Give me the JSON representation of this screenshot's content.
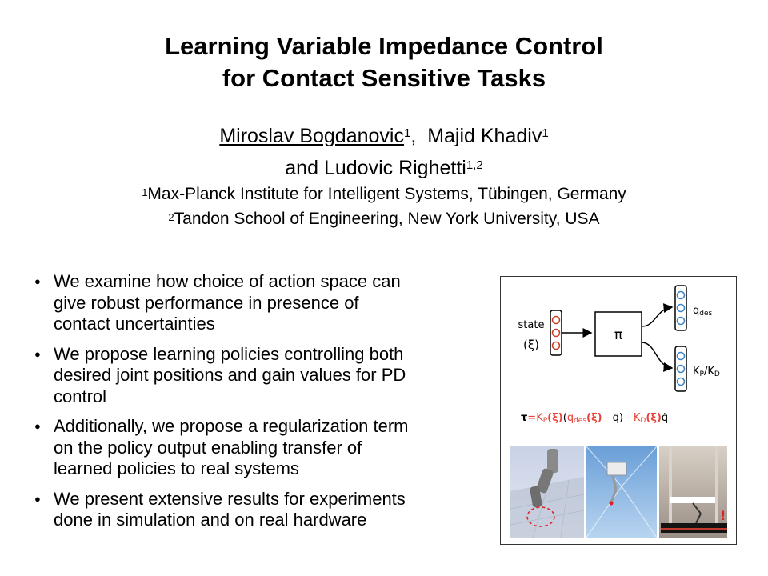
{
  "title": {
    "line1": "Learning Variable Impedance Control",
    "line2": "for Contact Sensitive Tasks"
  },
  "authors": {
    "author1": "Miroslav Bogdanovic",
    "author1_sup": "1",
    "author1_sep": ",",
    "author2": "Majid Khadiv",
    "author2_sup": "1",
    "connector": "and",
    "author3": "Ludovic Righetti",
    "author3_sup": "1,2"
  },
  "affiliations": [
    {
      "sup": "1",
      "text": "Max-Planck Institute for Intelligent Systems, Tübingen, Germany"
    },
    {
      "sup": "2",
      "text": "Tandon School of Engineering, New York University, USA"
    }
  ],
  "bullet_marker": "●",
  "bullets": [
    {
      "lines": [
        "We examine how choice of action space can",
        "give robust performance in presence of",
        "contact uncertainties"
      ]
    },
    {
      "lines": [
        "We propose learning policies controlling both",
        "desired joint positions and gain values for PD",
        "control"
      ]
    },
    {
      "lines": [
        "Additionally, we propose a regularization term",
        "on the policy output enabling transfer of",
        "learned policies to real systems"
      ]
    },
    {
      "lines": [
        "We present extensive results for experiments",
        "done in simulation and on real hardware"
      ]
    }
  ],
  "figure": {
    "state_label": "state",
    "state_symbol": "(ξ)",
    "policy_symbol": "π",
    "output1": "q",
    "output1_sub": "des",
    "output2": "K",
    "output2_sub1": "P",
    "output2_sep": "/K",
    "output2_sub2": "D",
    "equation": {
      "tau": "τ",
      "eq": "=",
      "kp": "K",
      "kp_sub": "P",
      "xi1": "(ξ)",
      "open": "(",
      "q": "q",
      "q_sub": "des",
      "xi2": "(ξ)",
      "minus_q": " - q) - ",
      "kd": "K",
      "kd_sub": "D",
      "xi3": "(ξ)",
      "qdot": "q̇"
    },
    "marker_text": "!",
    "colors": {
      "accent_red": "#e8453c",
      "node_blue": "#3d85c6",
      "node_red": "#cc4125"
    }
  }
}
